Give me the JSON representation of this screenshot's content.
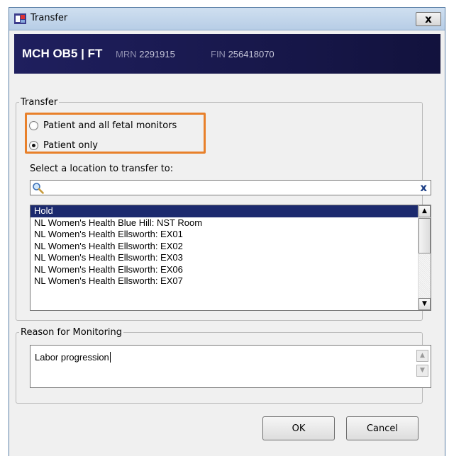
{
  "window": {
    "title": "Transfer",
    "close_label": "x",
    "icon": "app-icon"
  },
  "patient_banner": {
    "name": "MCH OB5 | FT",
    "mrn_label": "MRN",
    "mrn_value": "2291915",
    "fin_label": "FIN",
    "fin_value": "256418070"
  },
  "transfer_group": {
    "legend": "Transfer",
    "options": [
      {
        "label": "Patient and all fetal monitors",
        "checked": false
      },
      {
        "label": "Patient only",
        "checked": true
      }
    ],
    "select_label": "Select a location to transfer to:",
    "search": {
      "value": "",
      "placeholder": "",
      "clear_icon": "x"
    },
    "locations": [
      {
        "label": "Hold",
        "selected": true
      },
      {
        "label": "NL Women's Health Blue Hill: NST Room",
        "selected": false
      },
      {
        "label": "NL Women's Health Ellsworth: EX01",
        "selected": false
      },
      {
        "label": "NL Women's Health Ellsworth: EX02",
        "selected": false
      },
      {
        "label": "NL Women's Health Ellsworth: EX03",
        "selected": false
      },
      {
        "label": "NL Women's Health Ellsworth: EX06",
        "selected": false
      },
      {
        "label": "NL Women's Health Ellsworth: EX07",
        "selected": false
      }
    ]
  },
  "reason_group": {
    "legend": "Reason for Monitoring",
    "value": "Labor progression"
  },
  "buttons": {
    "ok": "OK",
    "cancel": "Cancel"
  },
  "colors": {
    "highlight": "#e8802a",
    "banner": "#1f1f5e",
    "selection": "#1c2a6e"
  }
}
